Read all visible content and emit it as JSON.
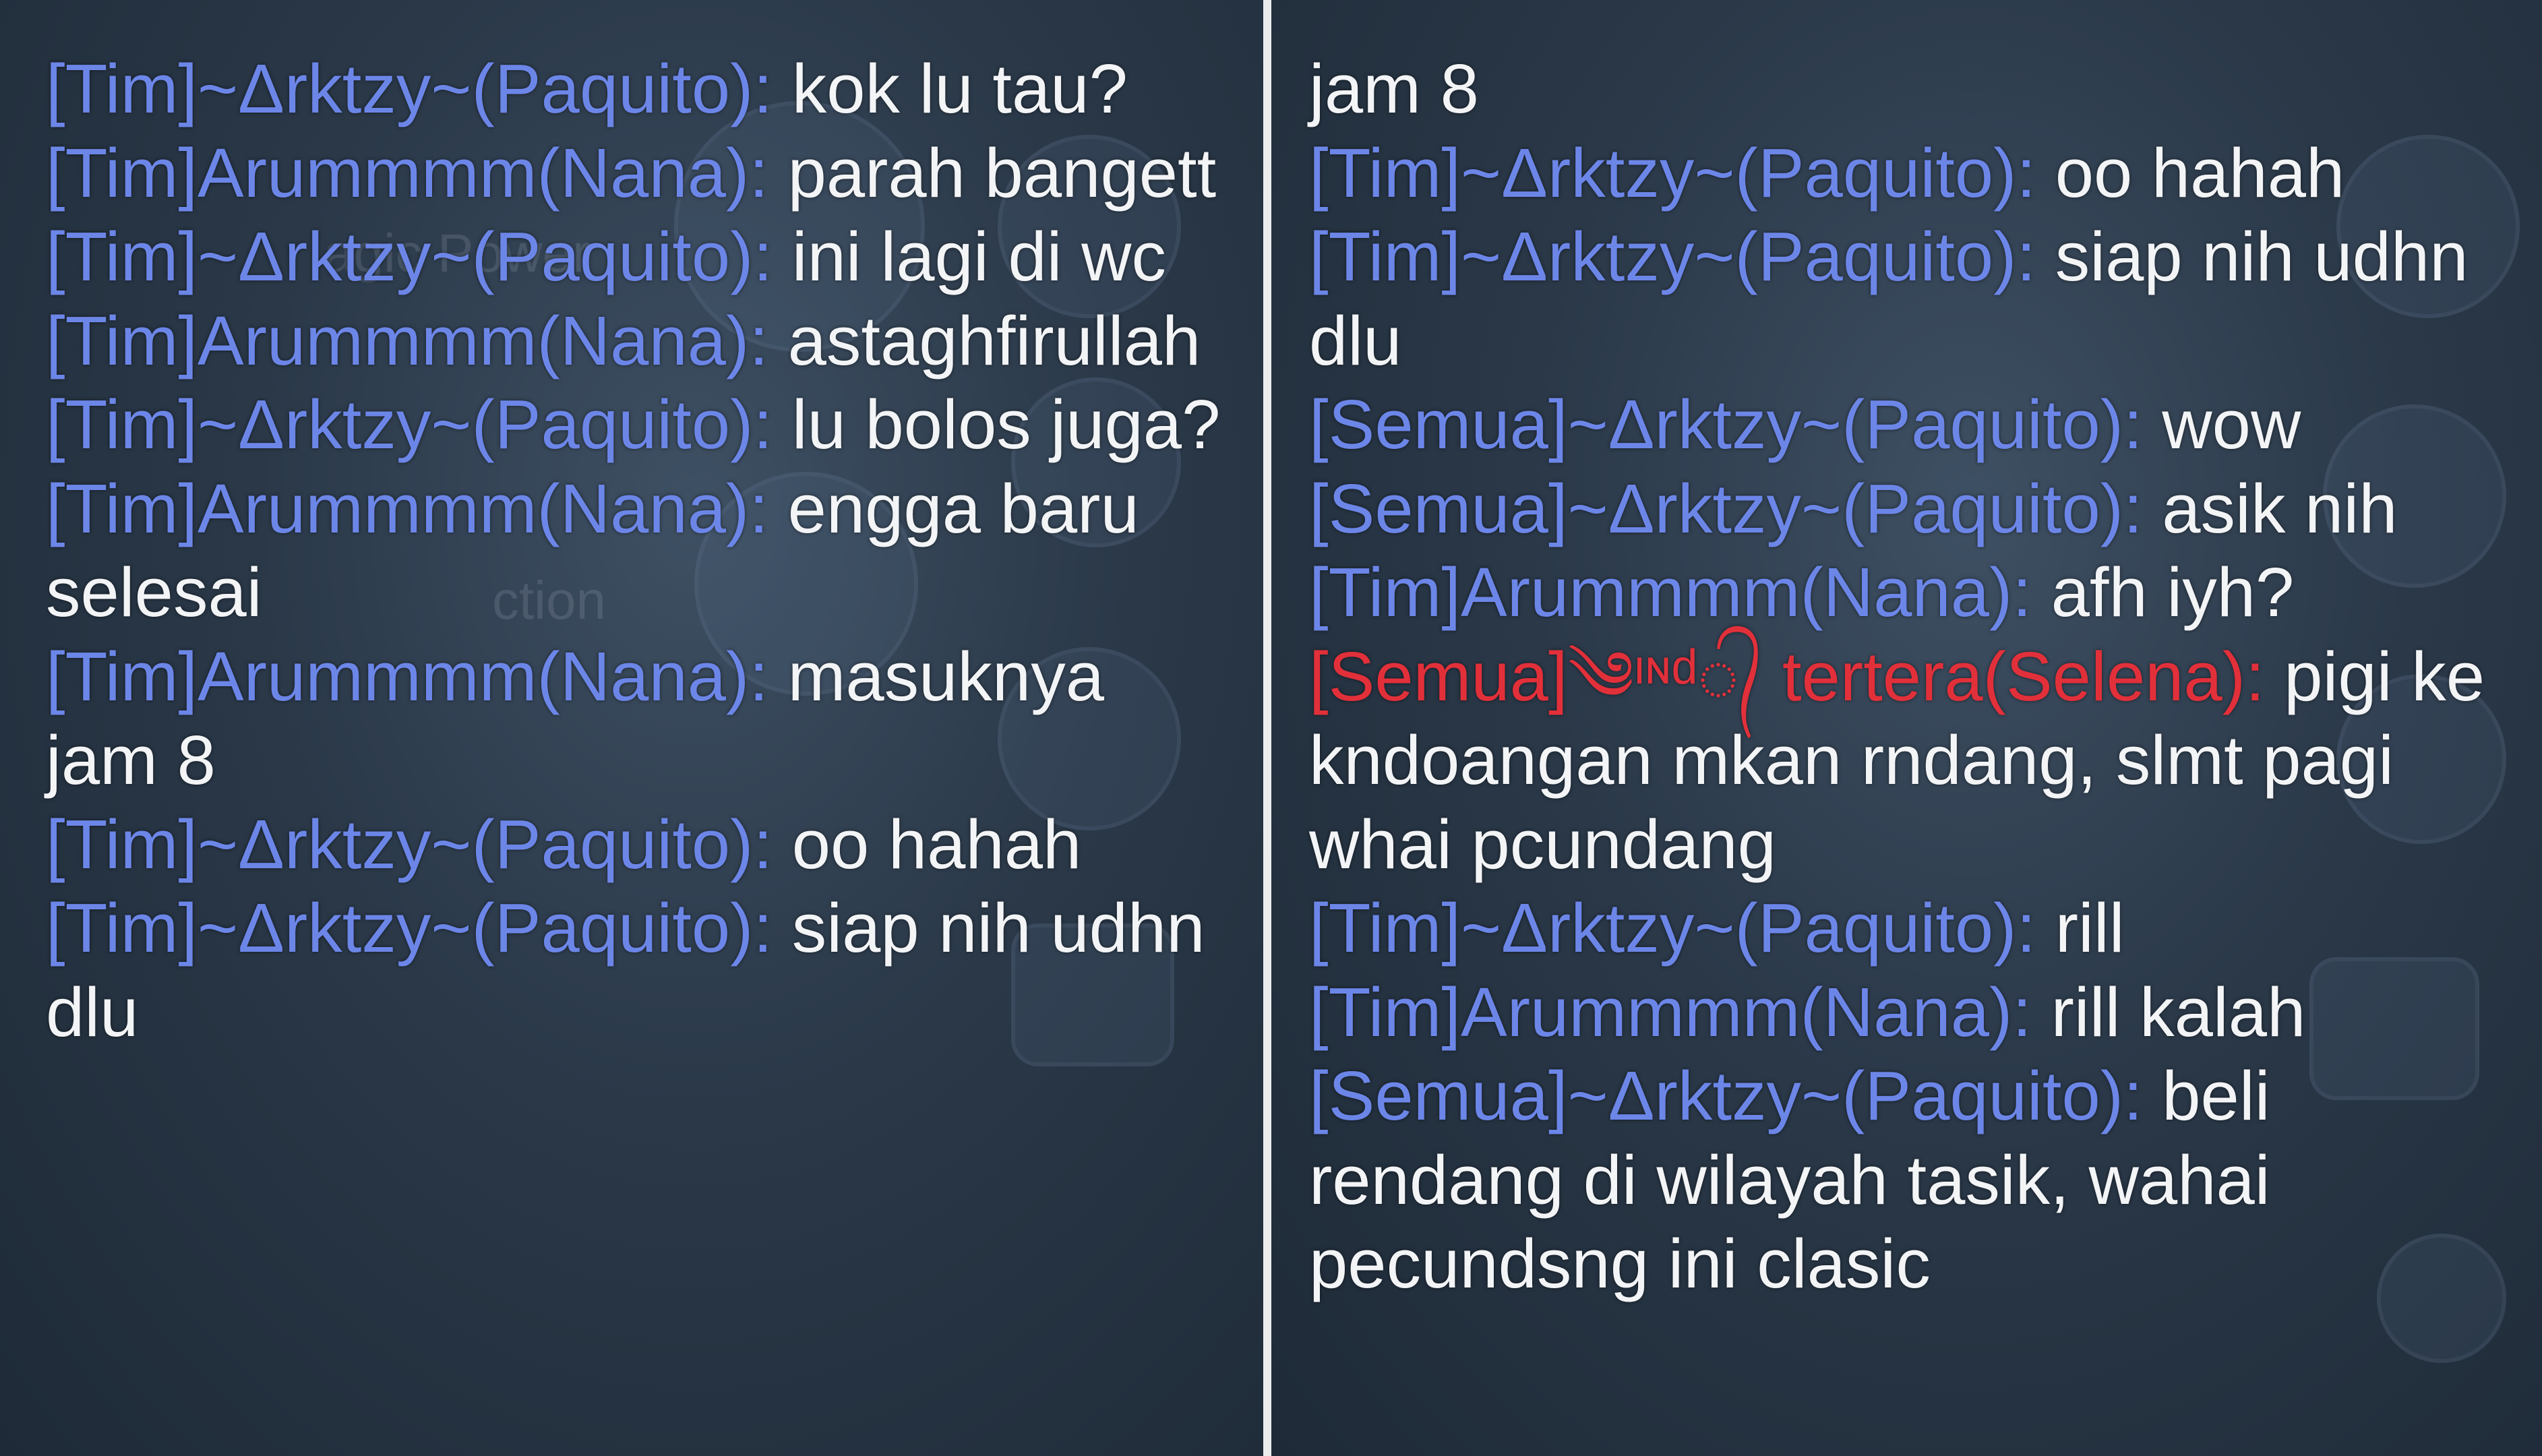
{
  "left_panel": {
    "background_overlay": {
      "faded_labels": [
        "agic Power",
        "ction"
      ]
    },
    "messages": [
      {
        "sender": "[Tim]~Δrktzy~(Paquito):",
        "text": " kok lu tau?",
        "sender_color": "#6c86e8"
      },
      {
        "sender": "[Tim]Arummmm(Nana):",
        "text": " parah bangett",
        "sender_color": "#6c86e8"
      },
      {
        "sender": "[Tim]~Δrktzy~(Paquito):",
        "text": " ini lagi di wc",
        "sender_color": "#6c86e8"
      },
      {
        "sender": "[Tim]Arummmm(Nana):",
        "text": " astaghfirullah",
        "sender_color": "#6c86e8"
      },
      {
        "sender": "[Tim]~Δrktzy~(Paquito):",
        "text": " lu bolos juga?",
        "sender_color": "#6c86e8"
      },
      {
        "sender": "[Tim]Arummmm(Nana):",
        "text": " engga baru selesai",
        "sender_color": "#6c86e8"
      },
      {
        "sender": "[Tim]Arummmm(Nana):",
        "text": " masuknya jam 8",
        "sender_color": "#6c86e8"
      },
      {
        "sender": "[Tim]~Δrktzy~(Paquito):",
        "text": " oo hahah",
        "sender_color": "#6c86e8"
      },
      {
        "sender": "[Tim]~Δrktzy~(Paquito):",
        "text": " siap nih udhn dlu",
        "sender_color": "#6c86e8"
      }
    ]
  },
  "right_panel": {
    "messages": [
      {
        "sender": "",
        "text": "jam 8",
        "sender_color": "#6c86e8"
      },
      {
        "sender": "[Tim]~Δrktzy~(Paquito):",
        "text": " oo hahah",
        "sender_color": "#6c86e8"
      },
      {
        "sender": "[Tim]~Δrktzy~(Paquito):",
        "text": " siap nih udhn dlu",
        "sender_color": "#6c86e8"
      },
      {
        "sender": "[Semua]~Δrktzy~(Paquito):",
        "text": " wow",
        "sender_color": "#6c86e8"
      },
      {
        "sender": "[Semua]~Δrktzy~(Paquito):",
        "text": " asik nih",
        "sender_color": "#6c86e8"
      },
      {
        "sender": "[Tim]Arummmm(Nana):",
        "text": " afh iyh?",
        "sender_color": "#6c86e8"
      },
      {
        "sender": "[Semua]༄ᶦᶰᵈ᭄ tertera(Selena):",
        "text": " pigi ke kndoangan mkan rndang, slmt pagi whai pcundang",
        "sender_color": "#e2303a"
      },
      {
        "sender": "[Tim]~Δrktzy~(Paquito):",
        "text": " rill",
        "sender_color": "#6c86e8"
      },
      {
        "sender": "[Tim]Arummmm(Nana):",
        "text": " rill kalah",
        "sender_color": "#6c86e8"
      },
      {
        "sender": "[Semua]~Δrktzy~(Paquito):",
        "text": " beli rendang di wilayah tasik, wahai pecundsng ini clasic",
        "sender_color": "#6c86e8"
      }
    ]
  }
}
